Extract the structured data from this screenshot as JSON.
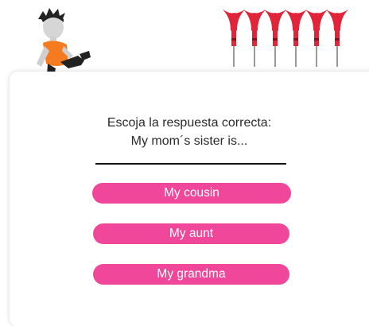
{
  "question": {
    "instruction": "Escoja la respuesta correcta:",
    "sentence": "My mom´s sister is..."
  },
  "options": [
    {
      "label": "My cousin"
    },
    {
      "label": "My aunt"
    },
    {
      "label": "My grandma"
    }
  ],
  "colors": {
    "accent": "#f0479a",
    "dart_red": "#e0243a"
  },
  "icons": {
    "character": "kid-character-icon",
    "darts": "darts-row-icon"
  }
}
